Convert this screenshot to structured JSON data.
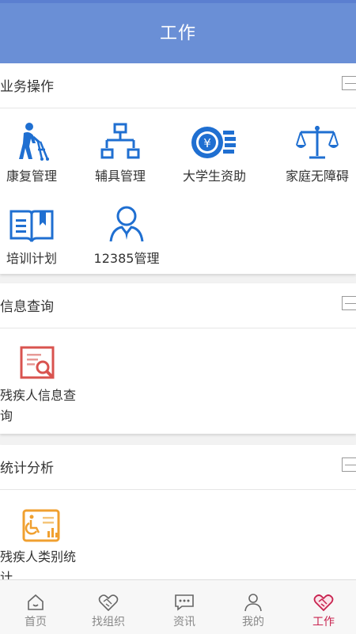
{
  "header": {
    "title": "工作"
  },
  "sections": [
    {
      "title": "业务操作",
      "items": [
        {
          "label": "康复管理",
          "icon": "elderly-walker-icon"
        },
        {
          "label": "辅具管理",
          "icon": "hierarchy-icon"
        },
        {
          "label": "大学生资助",
          "icon": "yen-coin-icon"
        },
        {
          "label": "家庭无障碍",
          "icon": "scales-icon"
        },
        {
          "label": "培训计划",
          "icon": "open-book-icon"
        },
        {
          "label": "12385管理",
          "icon": "user-profile-icon"
        }
      ]
    },
    {
      "title": "信息查询",
      "items": [
        {
          "label": "残疾人信息查询",
          "icon": "document-search-icon"
        }
      ]
    },
    {
      "title": "统计分析",
      "items": [
        {
          "label": "残疾人类别统计",
          "icon": "wheelchair-chart-icon"
        }
      ]
    }
  ],
  "tabbar": {
    "items": [
      {
        "label": "首页",
        "icon": "home-icon",
        "active": false
      },
      {
        "label": "找组织",
        "icon": "handshake-icon",
        "active": false
      },
      {
        "label": "资讯",
        "icon": "chat-bubble-icon",
        "active": false
      },
      {
        "label": "我的",
        "icon": "person-icon",
        "active": false
      },
      {
        "label": "工作",
        "icon": "handshake-heart-icon",
        "active": true
      }
    ]
  },
  "colors": {
    "header_bg": "#6a8fd6",
    "icon_blue": "#1f6fd1",
    "icon_red": "#d9534f",
    "icon_orange": "#f0a030",
    "active_tab": "#c8234f",
    "inactive_tab": "#888888"
  }
}
